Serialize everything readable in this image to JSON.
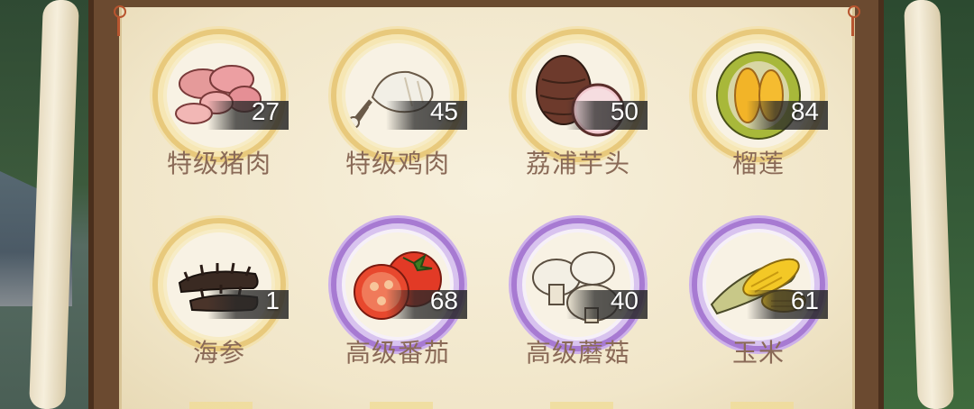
{
  "items": [
    {
      "name": "特级猪肉",
      "count": "27",
      "icon": "pork-icon",
      "rarity": "gold"
    },
    {
      "name": "特级鸡肉",
      "count": "45",
      "icon": "chicken-icon",
      "rarity": "gold"
    },
    {
      "name": "荔浦芋头",
      "count": "50",
      "icon": "taro-icon",
      "rarity": "gold"
    },
    {
      "name": "榴莲",
      "count": "84",
      "icon": "durian-icon",
      "rarity": "gold"
    },
    {
      "name": "海参",
      "count": "1",
      "icon": "sea-cucumber-icon",
      "rarity": "gold"
    },
    {
      "name": "高级番茄",
      "count": "68",
      "icon": "tomato-icon",
      "rarity": "purple"
    },
    {
      "name": "高级蘑菇",
      "count": "40",
      "icon": "mushroom-icon",
      "rarity": "purple"
    },
    {
      "name": "玉米",
      "count": "61",
      "icon": "corn-icon",
      "rarity": "purple"
    }
  ],
  "colors": {
    "gold_ring": "#e8c97c",
    "purple_ring": "#a77ad2",
    "name_text": "#8a6a57",
    "paper": "#f3e9cf"
  }
}
